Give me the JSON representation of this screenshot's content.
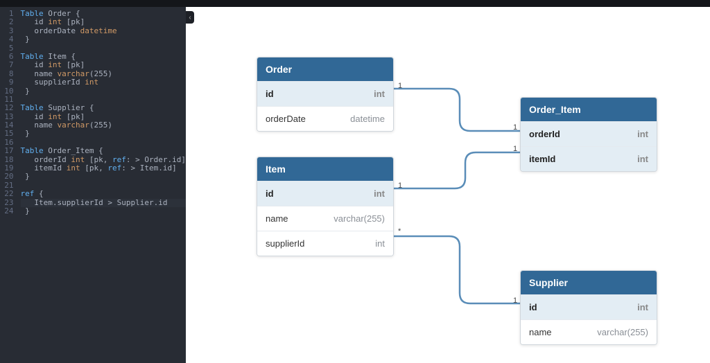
{
  "editor": {
    "lines": [
      {
        "n": 1,
        "segs": [
          {
            "t": "Table ",
            "c": "kw1"
          },
          {
            "t": "Order {",
            "c": "tname"
          }
        ]
      },
      {
        "n": 2,
        "segs": [
          {
            "t": "   ",
            "c": ""
          },
          {
            "t": "id ",
            "c": "fname"
          },
          {
            "t": "int ",
            "c": "type"
          },
          {
            "t": "[pk]",
            "c": "attr"
          }
        ]
      },
      {
        "n": 3,
        "segs": [
          {
            "t": "   ",
            "c": ""
          },
          {
            "t": "orderDate ",
            "c": "fname"
          },
          {
            "t": "datetime",
            "c": "type"
          }
        ]
      },
      {
        "n": 4,
        "segs": [
          {
            "t": " }",
            "c": "br"
          }
        ]
      },
      {
        "n": 5,
        "segs": []
      },
      {
        "n": 6,
        "segs": [
          {
            "t": "Table ",
            "c": "kw1"
          },
          {
            "t": "Item {",
            "c": "tname"
          }
        ]
      },
      {
        "n": 7,
        "segs": [
          {
            "t": "   ",
            "c": ""
          },
          {
            "t": "id ",
            "c": "fname"
          },
          {
            "t": "int ",
            "c": "type"
          },
          {
            "t": "[pk]",
            "c": "attr"
          }
        ]
      },
      {
        "n": 8,
        "segs": [
          {
            "t": "   ",
            "c": ""
          },
          {
            "t": "name ",
            "c": "fname"
          },
          {
            "t": "varchar",
            "c": "type"
          },
          {
            "t": "(255)",
            "c": "attr"
          }
        ]
      },
      {
        "n": 9,
        "segs": [
          {
            "t": "   ",
            "c": ""
          },
          {
            "t": "supplierId ",
            "c": "fname"
          },
          {
            "t": "int",
            "c": "type"
          }
        ]
      },
      {
        "n": 10,
        "segs": [
          {
            "t": " }",
            "c": "br"
          }
        ]
      },
      {
        "n": 11,
        "segs": []
      },
      {
        "n": 12,
        "segs": [
          {
            "t": "Table ",
            "c": "kw1"
          },
          {
            "t": "Supplier {",
            "c": "tname"
          }
        ]
      },
      {
        "n": 13,
        "segs": [
          {
            "t": "   ",
            "c": ""
          },
          {
            "t": "id ",
            "c": "fname"
          },
          {
            "t": "int ",
            "c": "type"
          },
          {
            "t": "[pk]",
            "c": "attr"
          }
        ]
      },
      {
        "n": 14,
        "segs": [
          {
            "t": "   ",
            "c": ""
          },
          {
            "t": "name ",
            "c": "fname"
          },
          {
            "t": "varchar",
            "c": "type"
          },
          {
            "t": "(255)",
            "c": "attr"
          }
        ]
      },
      {
        "n": 15,
        "segs": [
          {
            "t": " }",
            "c": "br"
          }
        ]
      },
      {
        "n": 16,
        "segs": []
      },
      {
        "n": 17,
        "segs": [
          {
            "t": "Table ",
            "c": "kw1"
          },
          {
            "t": "Order_Item {",
            "c": "tname"
          }
        ]
      },
      {
        "n": 18,
        "segs": [
          {
            "t": "   ",
            "c": ""
          },
          {
            "t": "orderId ",
            "c": "fname"
          },
          {
            "t": "int ",
            "c": "type"
          },
          {
            "t": "[pk, ",
            "c": "attr"
          },
          {
            "t": "ref",
            "c": "kw1"
          },
          {
            "t": ": > Order.id]",
            "c": "attr"
          }
        ]
      },
      {
        "n": 19,
        "segs": [
          {
            "t": "   ",
            "c": ""
          },
          {
            "t": "itemId ",
            "c": "fname"
          },
          {
            "t": "int ",
            "c": "type"
          },
          {
            "t": "[pk, ",
            "c": "attr"
          },
          {
            "t": "ref",
            "c": "kw1"
          },
          {
            "t": ": > Item.id]",
            "c": "attr"
          }
        ]
      },
      {
        "n": 20,
        "segs": [
          {
            "t": " }",
            "c": "br"
          }
        ]
      },
      {
        "n": 21,
        "segs": []
      },
      {
        "n": 22,
        "segs": [
          {
            "t": "ref ",
            "c": "kw1"
          },
          {
            "t": "{",
            "c": "br"
          }
        ]
      },
      {
        "n": 23,
        "segs": [
          {
            "t": "   Item.supplierId > Supplier.id",
            "c": "fname"
          }
        ],
        "hl": true
      },
      {
        "n": 24,
        "segs": [
          {
            "t": " }",
            "c": "br"
          }
        ]
      }
    ]
  },
  "tables": {
    "order": {
      "title": "Order",
      "cols": [
        {
          "name": "id",
          "type": "int",
          "key": true
        },
        {
          "name": "orderDate",
          "type": "datetime",
          "key": false
        }
      ]
    },
    "order_item": {
      "title": "Order_Item",
      "cols": [
        {
          "name": "orderId",
          "type": "int",
          "key": true
        },
        {
          "name": "itemId",
          "type": "int",
          "key": true
        }
      ]
    },
    "item": {
      "title": "Item",
      "cols": [
        {
          "name": "id",
          "type": "int",
          "key": true
        },
        {
          "name": "name",
          "type": "varchar(255)",
          "key": false
        },
        {
          "name": "supplierId",
          "type": "int",
          "key": false
        }
      ]
    },
    "supplier": {
      "title": "Supplier",
      "cols": [
        {
          "name": "id",
          "type": "int",
          "key": true
        },
        {
          "name": "name",
          "type": "varchar(255)",
          "key": false
        }
      ]
    }
  },
  "cardinality": {
    "one": "1",
    "many": "*"
  },
  "collapse_glyph": "‹"
}
